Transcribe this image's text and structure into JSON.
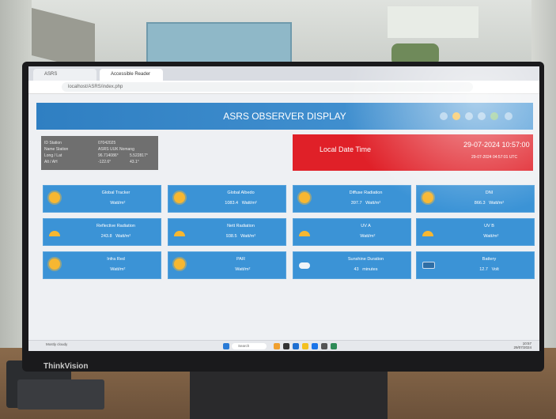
{
  "browser": {
    "tabs": [
      "ASRS",
      "Accessible Reader"
    ],
    "url": "localhost/ASRS/index.php"
  },
  "header": {
    "title": "ASRS OBSERVER DISPLAY"
  },
  "station": {
    "rows": [
      {
        "key": "ID Station",
        "v1": "07042025",
        "v2": ""
      },
      {
        "key": "Name Station",
        "v1": "ASRS UUK Nomang",
        "v2": ""
      },
      {
        "key": "Long / Lat",
        "v1": "96.714086°",
        "v2": "5.522817°"
      },
      {
        "key": "Alt / AH",
        "v1": "-122.6°",
        "v2": "43.1°"
      }
    ]
  },
  "datetime": {
    "label": "Local Date Time",
    "value": "29-07-2024 10:57:00",
    "utc": "29-07-2024 04:57:01 UTC"
  },
  "cards": [
    {
      "label": "Global Tracker",
      "number": "",
      "unit": "Watt/m²",
      "icon": "sun-icon"
    },
    {
      "label": "Global Albedo",
      "number": "1083.4",
      "unit": "Watt/m²",
      "icon": "sun-icon"
    },
    {
      "label": "Diffuse Radiation",
      "number": "397.7",
      "unit": "Watt/m²",
      "icon": "sun-icon"
    },
    {
      "label": "DNI",
      "number": "866.3",
      "unit": "Watt/m²",
      "icon": "sun-icon"
    },
    {
      "label": "Reflective Radiation",
      "number": "243.8",
      "unit": "Watt/m²",
      "icon": "sunset-icon"
    },
    {
      "label": "Nett Radiation",
      "number": "938.5",
      "unit": "Watt/m²",
      "icon": "sunset-icon"
    },
    {
      "label": "UV A",
      "number": "",
      "unit": "Watt/m²",
      "icon": "sunset-icon"
    },
    {
      "label": "UV B",
      "number": "",
      "unit": "Watt/m²",
      "icon": "sunset-icon"
    },
    {
      "label": "Infra Red",
      "number": "",
      "unit": "Watt/m²",
      "icon": "sun-icon"
    },
    {
      "label": "PAR",
      "number": "",
      "unit": "Watt/m²",
      "icon": "sun-icon"
    },
    {
      "label": "Sunshine Duration",
      "number": "43",
      "unit": "minutes",
      "icon": "cloud-icon"
    },
    {
      "label": "Battery",
      "number": "12.7",
      "unit": "Volt",
      "icon": "battery-icon"
    }
  ],
  "taskbar": {
    "search": "Search",
    "weather": "Mostly cloudy",
    "time": "10:57",
    "date": "29/07/2024"
  },
  "monitor": {
    "brand": "ThinkVision"
  },
  "colors": {
    "header_blue": "#3b8bd0",
    "card_blue": "#3b93d6",
    "datetime_red": "#e02028",
    "info_gray": "#6f6f6f"
  }
}
